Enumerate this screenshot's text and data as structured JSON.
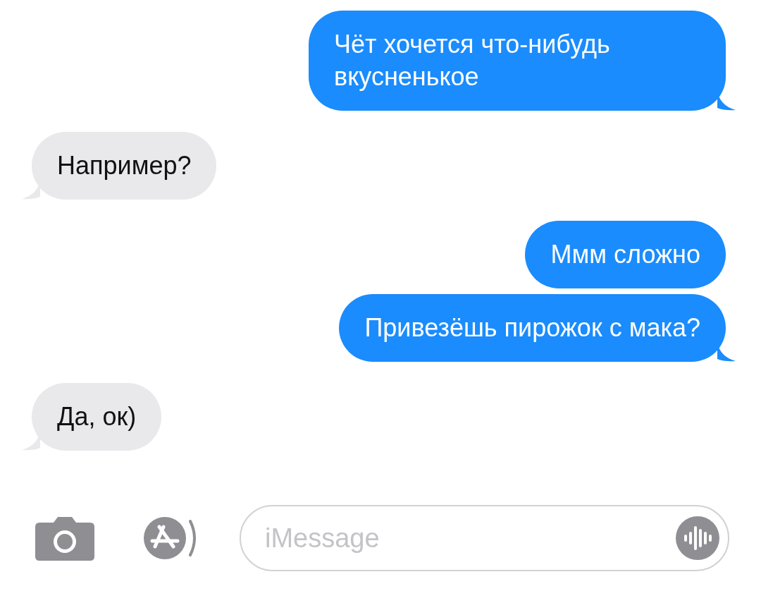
{
  "messages": [
    {
      "kind": "sent",
      "tail": true,
      "text": "Чёт хочется что-нибудь вкусненькое"
    },
    {
      "kind": "received",
      "tail": true,
      "text": "Например?"
    },
    {
      "kind": "sent",
      "tail": false,
      "text": "Ммм сложно"
    },
    {
      "kind": "sent",
      "tail": true,
      "text": "Привезёшь пирожок с мака?"
    },
    {
      "kind": "received",
      "tail": true,
      "text": "Да, ок)"
    }
  ],
  "composer": {
    "placeholder": "iMessage"
  }
}
